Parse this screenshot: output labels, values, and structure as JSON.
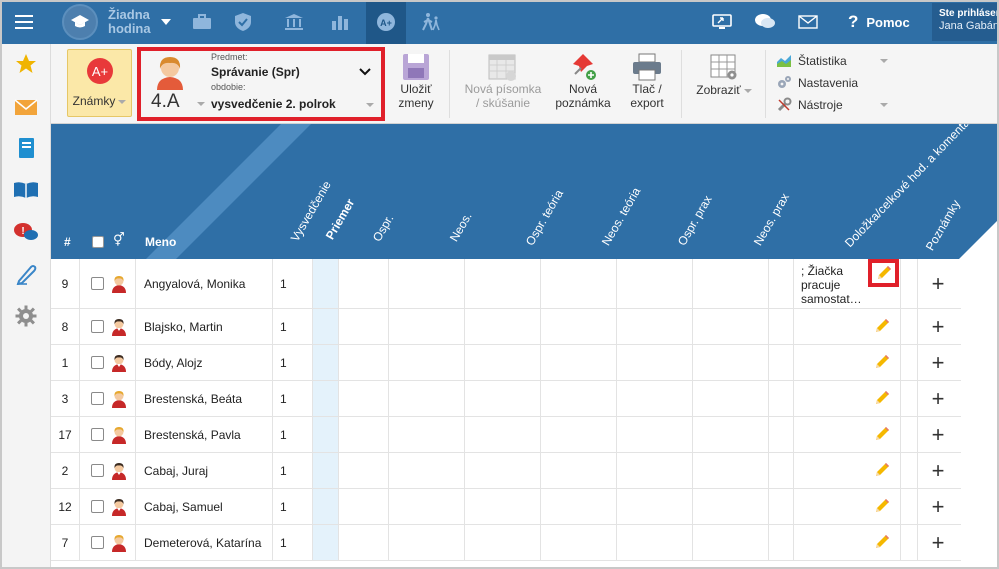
{
  "topbar": {
    "lesson_line1": "Žiadna",
    "lesson_line2": "hodina",
    "help_label": "Pomoc",
    "user_line1": "Ste prihlásen",
    "user_line2": "Jana Gabán"
  },
  "toolbar": {
    "znamky_label": "Známky",
    "predmet_label": "Predmet:",
    "predmet_value": "Správanie (Spr)",
    "class_value": "4.A",
    "obdobie_label": "obdobie:",
    "obdobie_value": "vysvedčenie 2. polrok",
    "save_line1": "Uložiť",
    "save_line2": "zmeny",
    "test_line1": "Nová písomka",
    "test_line2": "/ skúšanie",
    "note_line1": "Nová",
    "note_line2": "poznámka",
    "print_line1": "Tlač /",
    "print_line2": "export",
    "show_label": "Zobraziť",
    "stat_label": "Štatistika",
    "settings_label": "Nastavenia",
    "tools_label": "Nástroje"
  },
  "header": {
    "hash": "#",
    "meno": "Meno",
    "columns": [
      "Vysvedčenie",
      "Priemer",
      "Ospr.",
      "Neos.",
      "Ospr. teória",
      "Neos. teória",
      "Ospr. prax",
      "Neos. prax",
      "Doložka/celkové hod. a komentár",
      "Poznámky"
    ]
  },
  "students": [
    {
      "num": "9",
      "name": "Angyalová, Monika",
      "grade": "1",
      "gender": "f",
      "note": "; Žiačka pracuje samostat…"
    },
    {
      "num": "8",
      "name": "Blajsko, Martin",
      "grade": "1",
      "gender": "m",
      "note": ""
    },
    {
      "num": "1",
      "name": "Bódy, Alojz",
      "grade": "1",
      "gender": "m",
      "note": ""
    },
    {
      "num": "3",
      "name": "Brestenská, Beáta",
      "grade": "1",
      "gender": "f",
      "note": ""
    },
    {
      "num": "17",
      "name": "Brestenská, Pavla",
      "grade": "1",
      "gender": "f",
      "note": ""
    },
    {
      "num": "2",
      "name": "Cabaj, Juraj",
      "grade": "1",
      "gender": "m",
      "note": ""
    },
    {
      "num": "12",
      "name": "Cabaj, Samuel",
      "grade": "1",
      "gender": "m",
      "note": ""
    },
    {
      "num": "7",
      "name": "Demeterová, Katarína",
      "grade": "1",
      "gender": "f",
      "note": ""
    }
  ],
  "colors": {
    "topbar": "#2f6fa6",
    "header": "#2f6fa6",
    "highlight": "#e0202a",
    "znamky_bg": "#fbe8a8"
  },
  "icons": {
    "sidebar": [
      "star-icon",
      "mail-icon",
      "notebook-icon",
      "book-icon",
      "chat-alert-icon",
      "pen-icon",
      "gear-icon"
    ],
    "topnav": [
      "briefcase-icon",
      "shield-icon",
      "bank-icon",
      "bar-chart-icon",
      "grade-icon",
      "walk-icon"
    ],
    "right_tools": [
      "screen-share-icon",
      "chat-icon",
      "mail-icon",
      "help-icon"
    ]
  }
}
